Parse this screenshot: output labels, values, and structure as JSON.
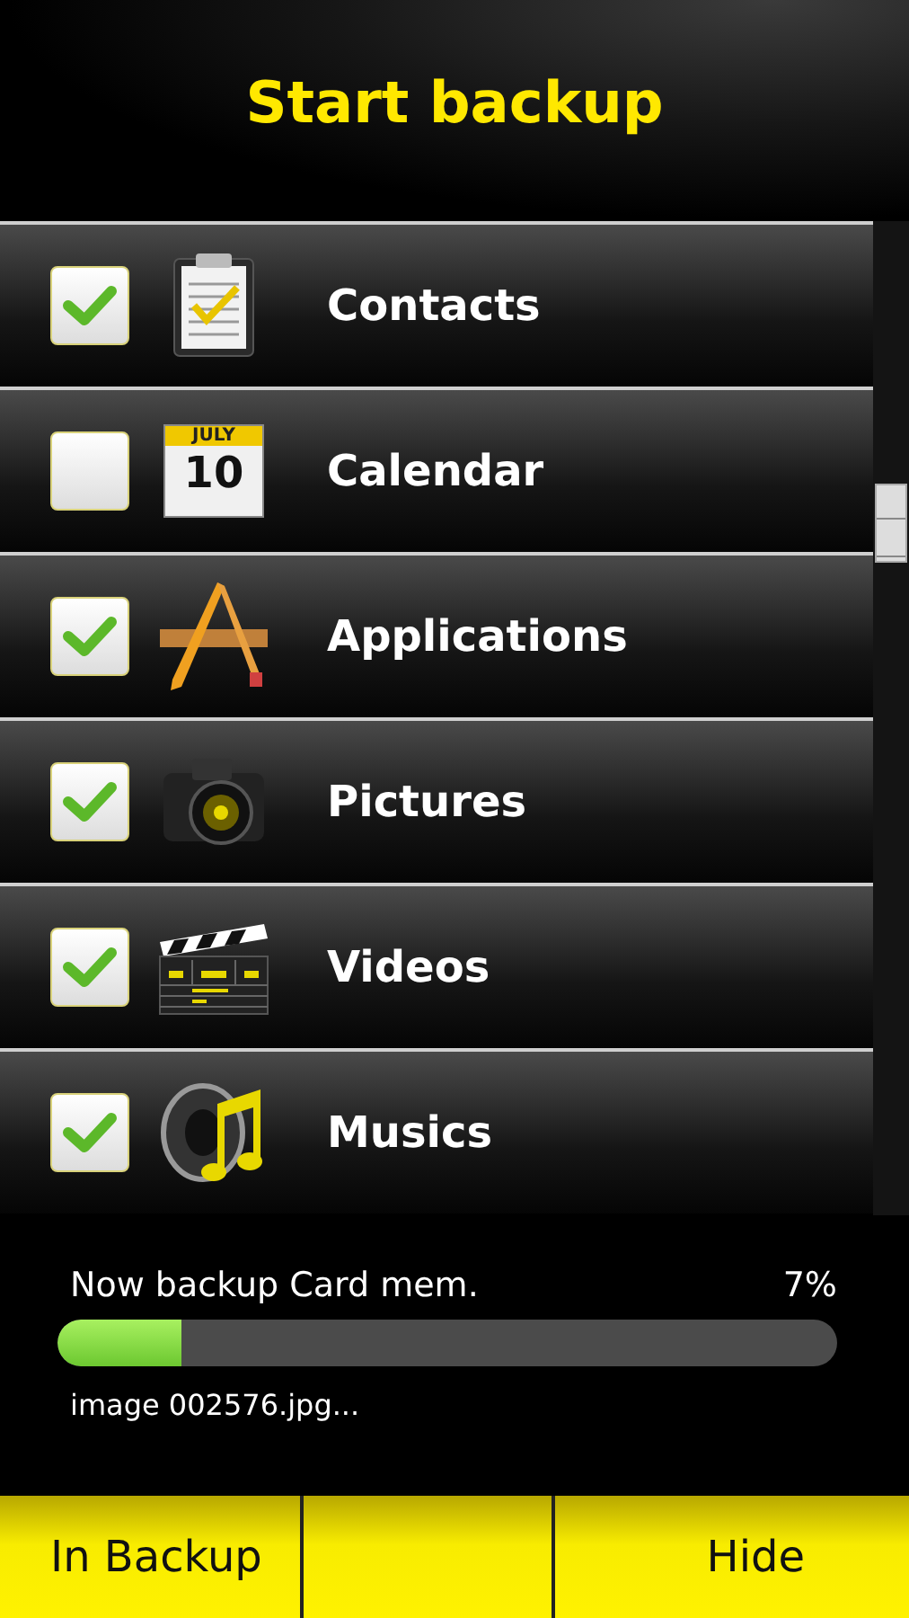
{
  "title": "Start backup",
  "items": [
    {
      "label": "Contacts",
      "checked": true
    },
    {
      "label": "Calendar",
      "checked": false,
      "icon_texts": [
        "JULY",
        "10"
      ]
    },
    {
      "label": "Applications",
      "checked": true
    },
    {
      "label": "Pictures",
      "checked": true
    },
    {
      "label": "Videos",
      "checked": true
    },
    {
      "label": "Musics",
      "checked": true
    }
  ],
  "progress": {
    "label": "Now backup Card mem.",
    "reading": "7%",
    "level": 0.16,
    "file": "image 002576.jpg..."
  },
  "buttons": [
    "In Backup",
    "Hide"
  ]
}
